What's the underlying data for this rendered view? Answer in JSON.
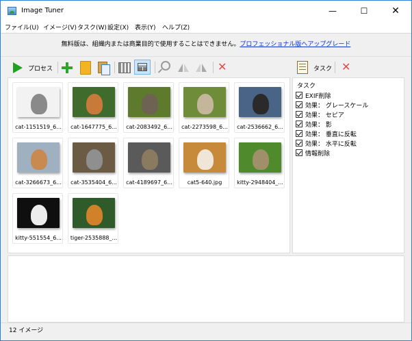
{
  "window": {
    "title": "Image Tuner",
    "min_glyph": "—",
    "max_glyph": "☐",
    "close_glyph": "✕"
  },
  "menu": {
    "items": [
      "ファイル(U)",
      "イメージ(V)",
      "タスク(W)",
      "設定(X)",
      "表示(Y)",
      "ヘルプ(Z)"
    ]
  },
  "notice": {
    "text": "無料版は、組織内または商業目的で使用することはできません。",
    "link": "プロフェッショナル版へアップグレード"
  },
  "toolbar": {
    "process_label": "プロセス",
    "task_label": "タスク",
    "delete_glyph": "✕",
    "icons": [
      "play-icon",
      "plus-icon",
      "folder-icon",
      "paste-icon",
      "columns-icon",
      "grid-view-icon",
      "zoom-icon",
      "flip-vertical-icon",
      "flip-horizontal-icon",
      "delete-icon",
      "task-list-icon",
      "task-delete-icon"
    ],
    "colors": {
      "play": "#22a022",
      "add": "#2ea52e",
      "delete": "#e04b4b",
      "selected_bg": "#cce4f7"
    }
  },
  "thumbnails": [
    {
      "label": "cat-1151519_6...",
      "bg": "#f2f2f2",
      "cat": "#8a8a8a"
    },
    {
      "label": "cat-1647775_6...",
      "bg": "#3f6b2c",
      "cat": "#c77a3a"
    },
    {
      "label": "cat-2083492_6...",
      "bg": "#5d7a2d",
      "cat": "#6e6252"
    },
    {
      "label": "cat-2273598_6...",
      "bg": "#6f8c3a",
      "cat": "#c4b69a"
    },
    {
      "label": "cat-2536662_6...",
      "bg": "#4a6488",
      "cat": "#2a2a2a"
    },
    {
      "label": "cat-3266673_6...",
      "bg": "#9fb0c0",
      "cat": "#c98a52"
    },
    {
      "label": "cat-3535404_6...",
      "bg": "#6b5a44",
      "cat": "#8f8f8f"
    },
    {
      "label": "cat-4189697_6...",
      "bg": "#5a5a5a",
      "cat": "#8a7a60"
    },
    {
      "label": "cat5-640.jpg",
      "bg": "#c78a3a",
      "cat": "#f0e6d8"
    },
    {
      "label": "kitty-2948404_...",
      "bg": "#4f8a2c",
      "cat": "#a0906a"
    },
    {
      "label": "kitty-551554_6...",
      "bg": "#0f0f0f",
      "cat": "#ececec"
    },
    {
      "label": "tiger-2535888_...",
      "bg": "#2f5a2a",
      "cat": "#d2812b"
    }
  ],
  "tasks": {
    "title": "タスク",
    "items": [
      {
        "label": "EXIF削除",
        "checked": true
      },
      {
        "label": "効果： グレースケール",
        "checked": true
      },
      {
        "label": "効果： セピア",
        "checked": true
      },
      {
        "label": "効果： 影",
        "checked": true
      },
      {
        "label": "効果： 垂直に反転",
        "checked": true
      },
      {
        "label": "効果： 水平に反転",
        "checked": true
      },
      {
        "label": "情報削除",
        "checked": true
      }
    ]
  },
  "status": {
    "text": "12 イメージ"
  }
}
